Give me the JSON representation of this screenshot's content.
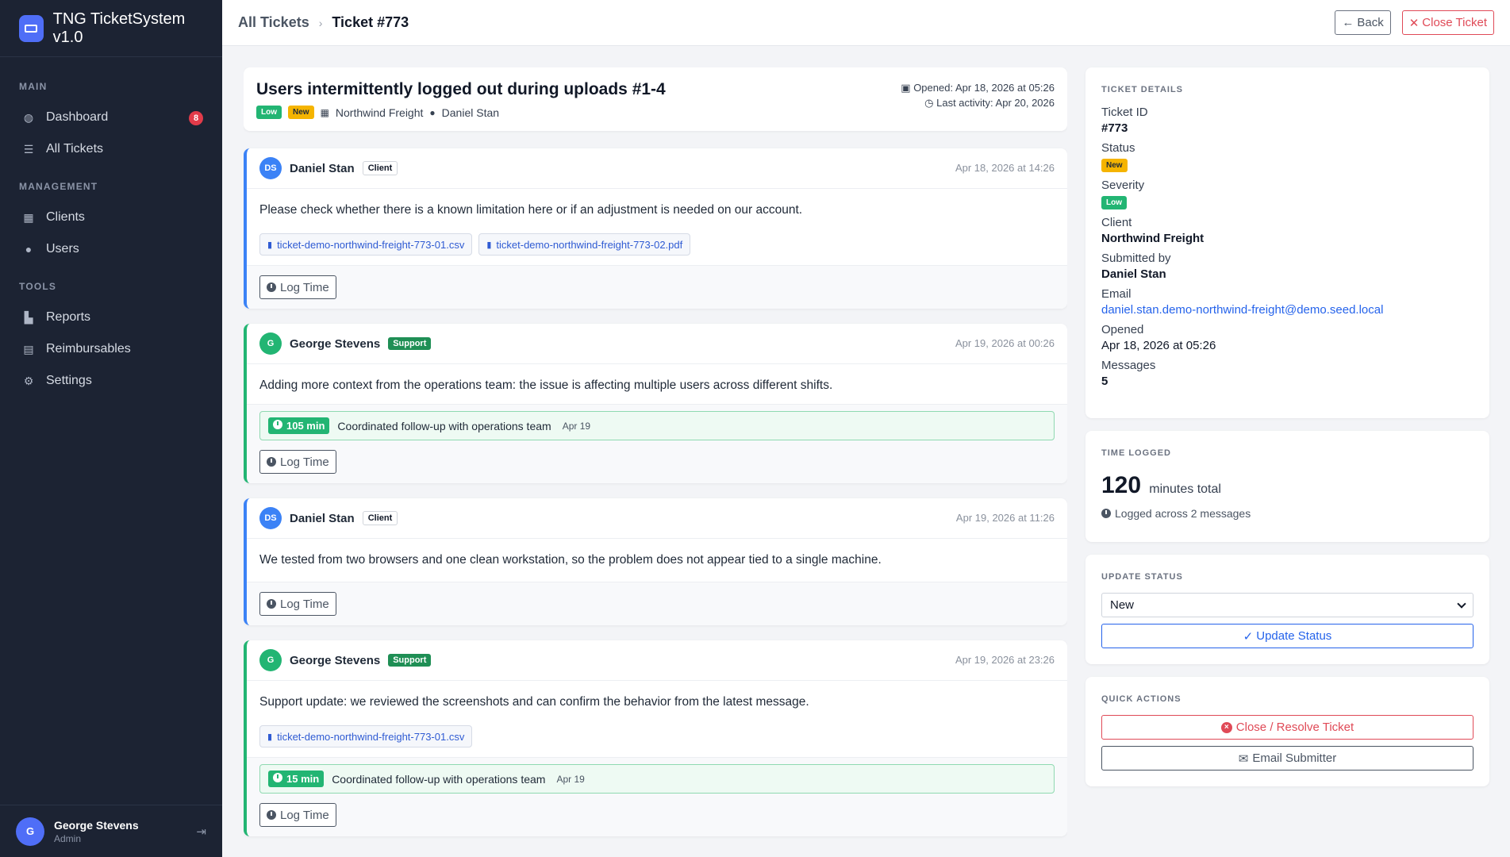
{
  "app": {
    "title": "TNG TicketSystem v1.0"
  },
  "sidebar": {
    "sections": [
      {
        "label": "MAIN",
        "items": [
          {
            "label": "Dashboard",
            "icon": "dashboard-icon",
            "badge": "8"
          },
          {
            "label": "All Tickets",
            "icon": "list-icon"
          }
        ]
      },
      {
        "label": "MANAGEMENT",
        "items": [
          {
            "label": "Clients",
            "icon": "building-icon"
          },
          {
            "label": "Users",
            "icon": "users-icon"
          }
        ]
      },
      {
        "label": "TOOLS",
        "items": [
          {
            "label": "Reports",
            "icon": "chart-icon"
          },
          {
            "label": "Reimbursables",
            "icon": "receipt-icon"
          },
          {
            "label": "Settings",
            "icon": "gear-icon"
          }
        ]
      }
    ],
    "user": {
      "initial": "G",
      "name": "George Stevens",
      "role": "Admin"
    }
  },
  "topbar": {
    "breadcrumb": {
      "parent": "All Tickets",
      "current": "Ticket #773"
    },
    "back_label": "Back",
    "close_label": "Close Ticket"
  },
  "ticket": {
    "title": "Users intermittently logged out during uploads #1-4",
    "severity": "Low",
    "status": "New",
    "client": "Northwind Freight",
    "submitter": "Daniel Stan",
    "opened": "Opened: Apr 18, 2026 at 05:26",
    "last_activity": "Last activity: Apr 20, 2026"
  },
  "messages": [
    {
      "initials": "DS",
      "author": "Daniel Stan",
      "role": "Client",
      "date": "Apr 18, 2026 at 14:26",
      "text": "Please check whether there is a known limitation here or if an adjustment is needed on our account.",
      "attachments": [
        "ticket-demo-northwind-freight-773-01.csv",
        "ticket-demo-northwind-freight-773-02.pdf"
      ],
      "log_label": "Log Time"
    },
    {
      "initials": "G",
      "author": "George Stevens",
      "role": "Support",
      "date": "Apr 19, 2026 at 00:26",
      "text": "Adding more context from the operations team: the issue is affecting multiple users across different shifts.",
      "time_entry": {
        "minutes": "105 min",
        "note": "Coordinated follow-up with operations team",
        "date": "Apr 19"
      },
      "log_label": "Log Time"
    },
    {
      "initials": "DS",
      "author": "Daniel Stan",
      "role": "Client",
      "date": "Apr 19, 2026 at 11:26",
      "text": "We tested from two browsers and one clean workstation, so the problem does not appear tied to a single machine.",
      "log_label": "Log Time"
    },
    {
      "initials": "G",
      "author": "George Stevens",
      "role": "Support",
      "date": "Apr 19, 2026 at 23:26",
      "text": "Support update: we reviewed the screenshots and can confirm the behavior from the latest message.",
      "attachments": [
        "ticket-demo-northwind-freight-773-01.csv"
      ],
      "time_entry": {
        "minutes": "15 min",
        "note": "Coordinated follow-up with operations team",
        "date": "Apr 19"
      },
      "log_label": "Log Time"
    }
  ],
  "details": {
    "title": "TICKET DETAILS",
    "ticket_id_label": "Ticket ID",
    "ticket_id": "#773",
    "status_label": "Status",
    "status": "New",
    "severity_label": "Severity",
    "severity": "Low",
    "client_label": "Client",
    "client": "Northwind Freight",
    "submitted_label": "Submitted by",
    "submitted_by": "Daniel Stan",
    "email_label": "Email",
    "email": "daniel.stan.demo-northwind-freight@demo.seed.local",
    "opened_label": "Opened",
    "opened": "Apr 18, 2026 at 05:26",
    "messages_label": "Messages",
    "messages": "5"
  },
  "time_logged": {
    "title": "TIME LOGGED",
    "total": "120",
    "suffix": "minutes total",
    "note": "Logged across 2 messages"
  },
  "update_status": {
    "title": "UPDATE STATUS",
    "selected": "New",
    "button": "Update Status"
  },
  "quick_actions": {
    "title": "QUICK ACTIONS",
    "close_resolve": "Close / Resolve Ticket",
    "email": "Email Submitter"
  },
  "colors": {
    "sidebar": "#1c2333",
    "accent": "#4f6ef7",
    "success": "#22b573",
    "warning": "#f5b400",
    "danger": "#e04a57",
    "client_border": "#3b82f6"
  }
}
